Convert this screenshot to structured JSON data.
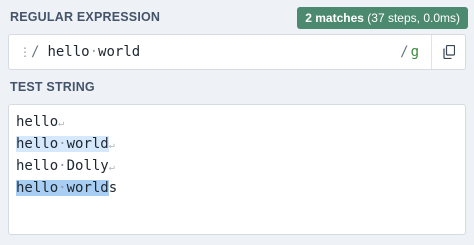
{
  "regex_section": {
    "title": "REGULAR EXPRESSION",
    "badge": {
      "count": "2 matches",
      "detail": " (37 steps, 0.0ms)"
    },
    "delim_open": "/",
    "pattern_parts": [
      "hello",
      "·",
      "world"
    ],
    "delim_close": "/",
    "flags": "g",
    "grip_icon": "drag-handle-icon",
    "copy_icon": "copy-icon"
  },
  "test_section": {
    "title": "TEST STRING",
    "lines": [
      {
        "parts": [
          "hello"
        ],
        "newline": "↵"
      },
      {
        "parts": [
          "hello",
          "·",
          "world"
        ],
        "newline": "↵",
        "match": true
      },
      {
        "parts": [
          "hello",
          "·",
          "Dolly"
        ],
        "newline": "↵"
      },
      {
        "parts": [
          "hello",
          "·",
          "world",
          "s"
        ],
        "match": true
      }
    ]
  },
  "colors": {
    "badge": "#4c8a6f",
    "match_light": "#d6e8fb",
    "match_dark": "#a8cff3",
    "flags": "#3b8a3b"
  }
}
